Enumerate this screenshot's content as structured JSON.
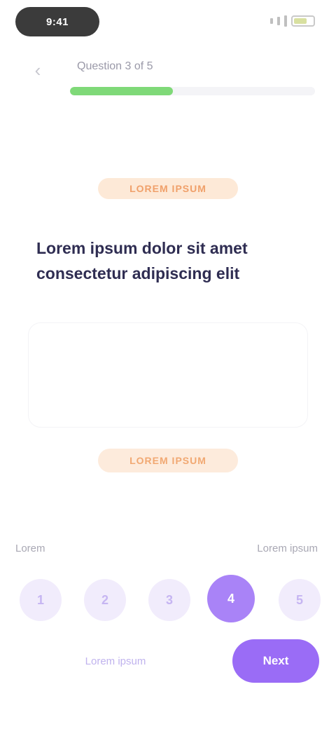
{
  "status_bar": {
    "time": "9:41",
    "battery_level": 0.7
  },
  "header": {
    "title": "Question 3 of 5",
    "progress": 0.42
  },
  "question": {
    "top_badge": "LOREM IPSUM",
    "text": "Lorem ipsum dolor sit amet consectetur adipiscing elit",
    "bottom_badge": "LOREM IPSUM"
  },
  "rating": {
    "low_label": "Lorem",
    "high_label": "Lorem ipsum",
    "options": [
      "1",
      "2",
      "3",
      "4",
      "5"
    ],
    "selected_index": 3
  },
  "actions": {
    "skip_label": "Lorem ipsum",
    "next_label": "Next"
  },
  "colors": {
    "accent": "#9a6cf6",
    "progress": "#7fd978",
    "badge": "#fde9d7"
  }
}
